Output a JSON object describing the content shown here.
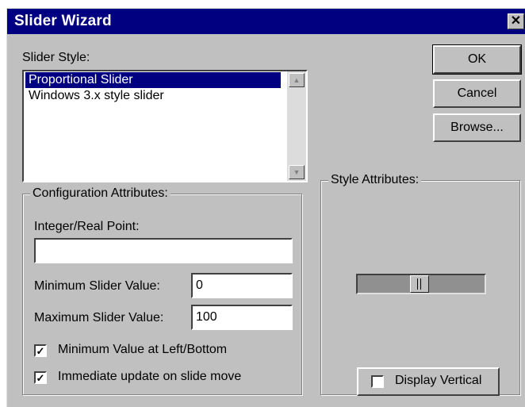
{
  "window": {
    "title": "Slider Wizard",
    "close_label": "✕"
  },
  "slider_style": {
    "label": "Slider Style:",
    "items": [
      {
        "label": "Proportional Slider",
        "selected": true
      },
      {
        "label": "Windows 3.x style slider",
        "selected": false
      }
    ]
  },
  "buttons": {
    "ok": "OK",
    "cancel": "Cancel",
    "browse": "Browse..."
  },
  "config": {
    "title": "Configuration Attributes:",
    "integer_label": "Integer/Real Point:",
    "integer_value": "",
    "min_label": "Minimum Slider Value:",
    "min_value": "0",
    "max_label": "Maximum Slider Value:",
    "max_value": "100",
    "check_min_left": {
      "label": "Minimum Value at Left/Bottom",
      "checked": true
    },
    "check_immediate": {
      "label": "Immediate update on slide move",
      "checked": true
    }
  },
  "style_attrs": {
    "title": "Style Attributes:",
    "slider_position_fraction": 0.5,
    "display_vertical": {
      "label": "Display Vertical",
      "checked": false
    }
  }
}
